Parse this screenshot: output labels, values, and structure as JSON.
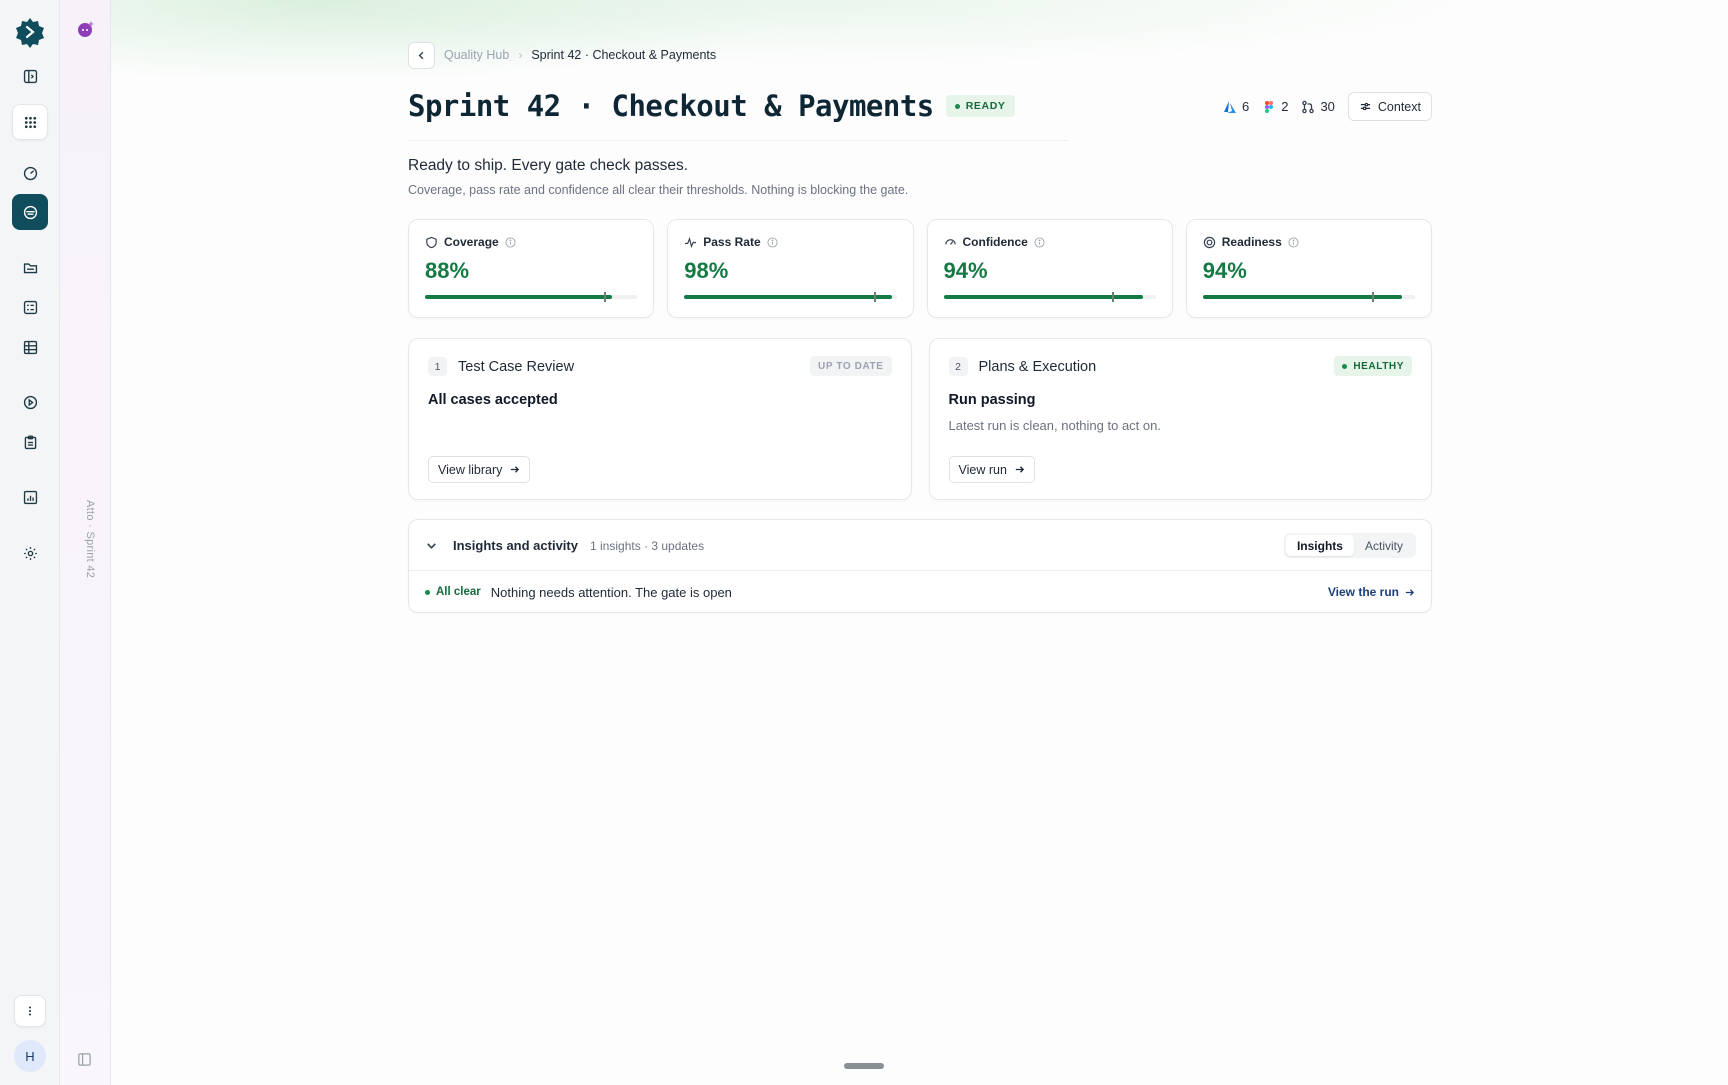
{
  "rail": {
    "logo": "gear-logo",
    "items": [
      {
        "icon": "sidebar-toggle-icon"
      },
      {
        "icon": "apps-grid-icon"
      },
      {
        "icon": "dashboard-gauge-icon"
      },
      {
        "icon": "quality-hub-icon"
      },
      {
        "icon": "folder-icon"
      },
      {
        "icon": "checklist-icon"
      },
      {
        "icon": "table-icon"
      },
      {
        "icon": "play-icon"
      },
      {
        "icon": "clipboard-icon"
      },
      {
        "icon": "report-chart-icon"
      },
      {
        "icon": "settings-gear-icon"
      }
    ],
    "more_icon": "more-vertical-icon",
    "avatar_initial": "H"
  },
  "secondary_rail": {
    "vertical_label": "Atto · Sprint 42"
  },
  "breadcrumb": {
    "parent": "Quality Hub",
    "current": "Sprint 42 · Checkout & Payments"
  },
  "header": {
    "title": "Sprint 42 · Checkout & Payments",
    "status_badge": "READY",
    "meta": {
      "azure_count": "6",
      "figma_count": "2",
      "pr_count": "30"
    },
    "context_button": "Context"
  },
  "summary": {
    "headline": "Ready to ship. Every gate check passes.",
    "description": "Coverage, pass rate and confidence all clear their thresholds. Nothing is blocking the gate."
  },
  "metrics": [
    {
      "label": "Coverage",
      "value": "88%",
      "fill": 0.88,
      "threshold": 0.85,
      "icon": "shield-icon"
    },
    {
      "label": "Pass Rate",
      "value": "98%",
      "fill": 0.98,
      "threshold": 0.9,
      "icon": "pulse-icon"
    },
    {
      "label": "Confidence",
      "value": "94%",
      "fill": 0.94,
      "threshold": 0.8,
      "icon": "gauge-icon"
    },
    {
      "label": "Readiness",
      "value": "94%",
      "fill": 0.94,
      "threshold": 0.8,
      "icon": "target-icon"
    }
  ],
  "panels": [
    {
      "number": "1",
      "title": "Test Case Review",
      "badge": "UP TO DATE",
      "status": "All cases accepted",
      "description": "",
      "button": "View library"
    },
    {
      "number": "2",
      "title": "Plans & Execution",
      "badge": "HEALTHY",
      "status": "Run passing",
      "description": "Latest run is clean, nothing to act on.",
      "button": "View run"
    }
  ],
  "insights": {
    "title": "Insights and activity",
    "summary": "1 insights · 3 updates",
    "tabs": [
      "Insights",
      "Activity"
    ],
    "active_tab": "Insights",
    "row": {
      "status": "All clear",
      "message": "Nothing needs attention. The gate is open",
      "link": "View the run"
    }
  },
  "colors": {
    "accent_green": "#147a43",
    "rail_active": "#0f4c5c",
    "link_blue": "#1d3f7a"
  }
}
